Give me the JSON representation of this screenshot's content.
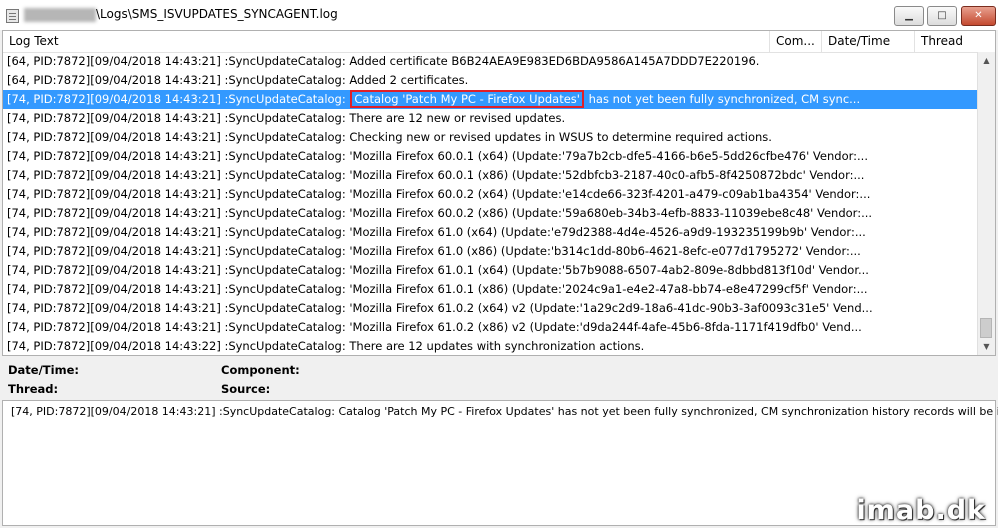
{
  "window": {
    "title": "\\Logs\\SMS_ISVUPDATES_SYNCAGENT.log",
    "minimize_label": "▁",
    "maximize_label": "□",
    "close_label": "✕"
  },
  "columns": [
    "Log Text",
    "Com...",
    "Date/Time",
    "Thread"
  ],
  "rows": [
    {
      "text": "[64, PID:7872][09/04/2018 14:43:21] :SyncUpdateCatalog: Added certificate B6B24AEA9E983ED6BDA9586A145A7DDD7E220196."
    },
    {
      "text": "[64, PID:7872][09/04/2018 14:43:21] :SyncUpdateCatalog: Added 2 certificates."
    },
    {
      "text": "[74, PID:7872][09/04/2018 14:43:21] :SyncUpdateCatalog: Catalog 'Patch My PC - Firefox Updates' has not yet been fully synchronized, CM sync...",
      "selected": true,
      "prefix": "[74, PID:7872][09/04/2018 14:43:21] :SyncUpdateCatalog:",
      "highlight": "Catalog 'Patch My PC - Firefox Updates'",
      "suffix": "has not yet been fully synchronized, CM sync..."
    },
    {
      "text": "[74, PID:7872][09/04/2018 14:43:21] :SyncUpdateCatalog: There are 12 new or revised updates."
    },
    {
      "text": "[74, PID:7872][09/04/2018 14:43:21] :SyncUpdateCatalog: Checking new or revised updates in WSUS to determine required actions."
    },
    {
      "text": "[74, PID:7872][09/04/2018 14:43:21] :SyncUpdateCatalog: 'Mozilla Firefox 60.0.1 (x64) (Update:'79a7b2cb-dfe5-4166-b6e5-5dd26cfbe476' Vendor:..."
    },
    {
      "text": "[74, PID:7872][09/04/2018 14:43:21] :SyncUpdateCatalog: 'Mozilla Firefox 60.0.1 (x86) (Update:'52dbfcb3-2187-40c0-afb5-8f4250872bdc' Vendor:..."
    },
    {
      "text": "[74, PID:7872][09/04/2018 14:43:21] :SyncUpdateCatalog: 'Mozilla Firefox 60.0.2 (x64) (Update:'e14cde66-323f-4201-a479-c09ab1ba4354' Vendor:..."
    },
    {
      "text": "[74, PID:7872][09/04/2018 14:43:21] :SyncUpdateCatalog: 'Mozilla Firefox 60.0.2 (x86) (Update:'59a680eb-34b3-4efb-8833-11039ebe8c48' Vendor:..."
    },
    {
      "text": "[74, PID:7872][09/04/2018 14:43:21] :SyncUpdateCatalog: 'Mozilla Firefox 61.0 (x64) (Update:'e79d2388-4d4e-4526-a9d9-193235199b9b' Vendor:..."
    },
    {
      "text": "[74, PID:7872][09/04/2018 14:43:21] :SyncUpdateCatalog: 'Mozilla Firefox 61.0 (x86) (Update:'b314c1dd-80b6-4621-8efc-e077d1795272' Vendor:..."
    },
    {
      "text": "[74, PID:7872][09/04/2018 14:43:21] :SyncUpdateCatalog: 'Mozilla Firefox 61.0.1 (x64) (Update:'5b7b9088-6507-4ab2-809e-8dbbd813f10d' Vendor..."
    },
    {
      "text": "[74, PID:7872][09/04/2018 14:43:21] :SyncUpdateCatalog: 'Mozilla Firefox 61.0.1 (x86) (Update:'2024c9a1-e4e2-47a8-bb74-e8e47299cf5f' Vendor:..."
    },
    {
      "text": "[74, PID:7872][09/04/2018 14:43:21] :SyncUpdateCatalog: 'Mozilla Firefox 61.0.2 (x64) v2 (Update:'1a29c2d9-18a6-41dc-90b3-3af0093c31e5' Vend..."
    },
    {
      "text": "[74, PID:7872][09/04/2018 14:43:21] :SyncUpdateCatalog: 'Mozilla Firefox 61.0.2 (x86) v2 (Update:'d9da244f-4afe-45b6-8fda-1171f419dfb0' Vend..."
    },
    {
      "text": "[74, PID:7872][09/04/2018 14:43:22] :SyncUpdateCatalog: There are 12 updates with synchronization actions."
    }
  ],
  "properties": {
    "datetime_label": "Date/Time:",
    "component_label": "Component:",
    "thread_label": "Thread:",
    "source_label": "Source:"
  },
  "detail": {
    "text": "[74, PID:7872][09/04/2018 14:43:21] :SyncUpdateCatalog: Catalog 'Patch My PC - Firefox Updates' has not yet been fully synchronized, CM synchronization history records will be ignored."
  },
  "watermark": "imab.dk",
  "colors": {
    "selection": "#3399ff",
    "highlight_border": "#e0202a"
  }
}
